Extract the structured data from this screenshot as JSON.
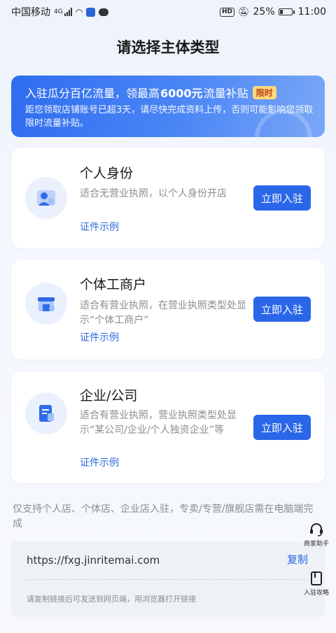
{
  "status_bar": {
    "carrier": "中国移动",
    "network": "4G",
    "battery_percent": "25%",
    "time": "11:00",
    "battery_level": 0.25
  },
  "header": {
    "title": "请选择主体类型"
  },
  "promo": {
    "prefix": "入驻瓜分百亿流量，领最高",
    "highlight": "6000元",
    "suffix": "流量补贴",
    "badge": "限时",
    "description": "距您领取店铺账号已超3天，请尽快完成资料上传，否则可能影响您领取限时流量补贴。"
  },
  "cards": [
    {
      "title": "个人身份",
      "description": "适合无营业执照，以个人身份开店",
      "sample_link": "证件示例",
      "button": "立即入驻",
      "icon": "person-id-icon"
    },
    {
      "title": "个体工商户",
      "description": "适合有营业执照，在营业执照类型处显示“个体工商户”",
      "sample_link": "证件示例",
      "button": "立即入驻",
      "icon": "storefront-icon"
    },
    {
      "title": "企业/公司",
      "description": "适合有营业执照，营业执照类型处显示“某公司/企业/个人独资企业”等",
      "sample_link": "证件示例",
      "button": "立即入驻",
      "icon": "company-doc-icon"
    }
  ],
  "footer": {
    "note": "仅支持个人店、个体店、企业店入驻，专卖/专营/旗舰店需在电脑端完成",
    "url": "https://fxg.jinritemai.com",
    "copy_label": "复制",
    "tip": "请复制链接后可发送到网页端，用浏览器打开链接"
  },
  "floating": {
    "assistant_label": "商家助手",
    "guide_label": "入驻攻略"
  },
  "colors": {
    "accent": "#2a66e8",
    "link": "#2a6ae0",
    "badge_bg": "#ffd87a"
  }
}
